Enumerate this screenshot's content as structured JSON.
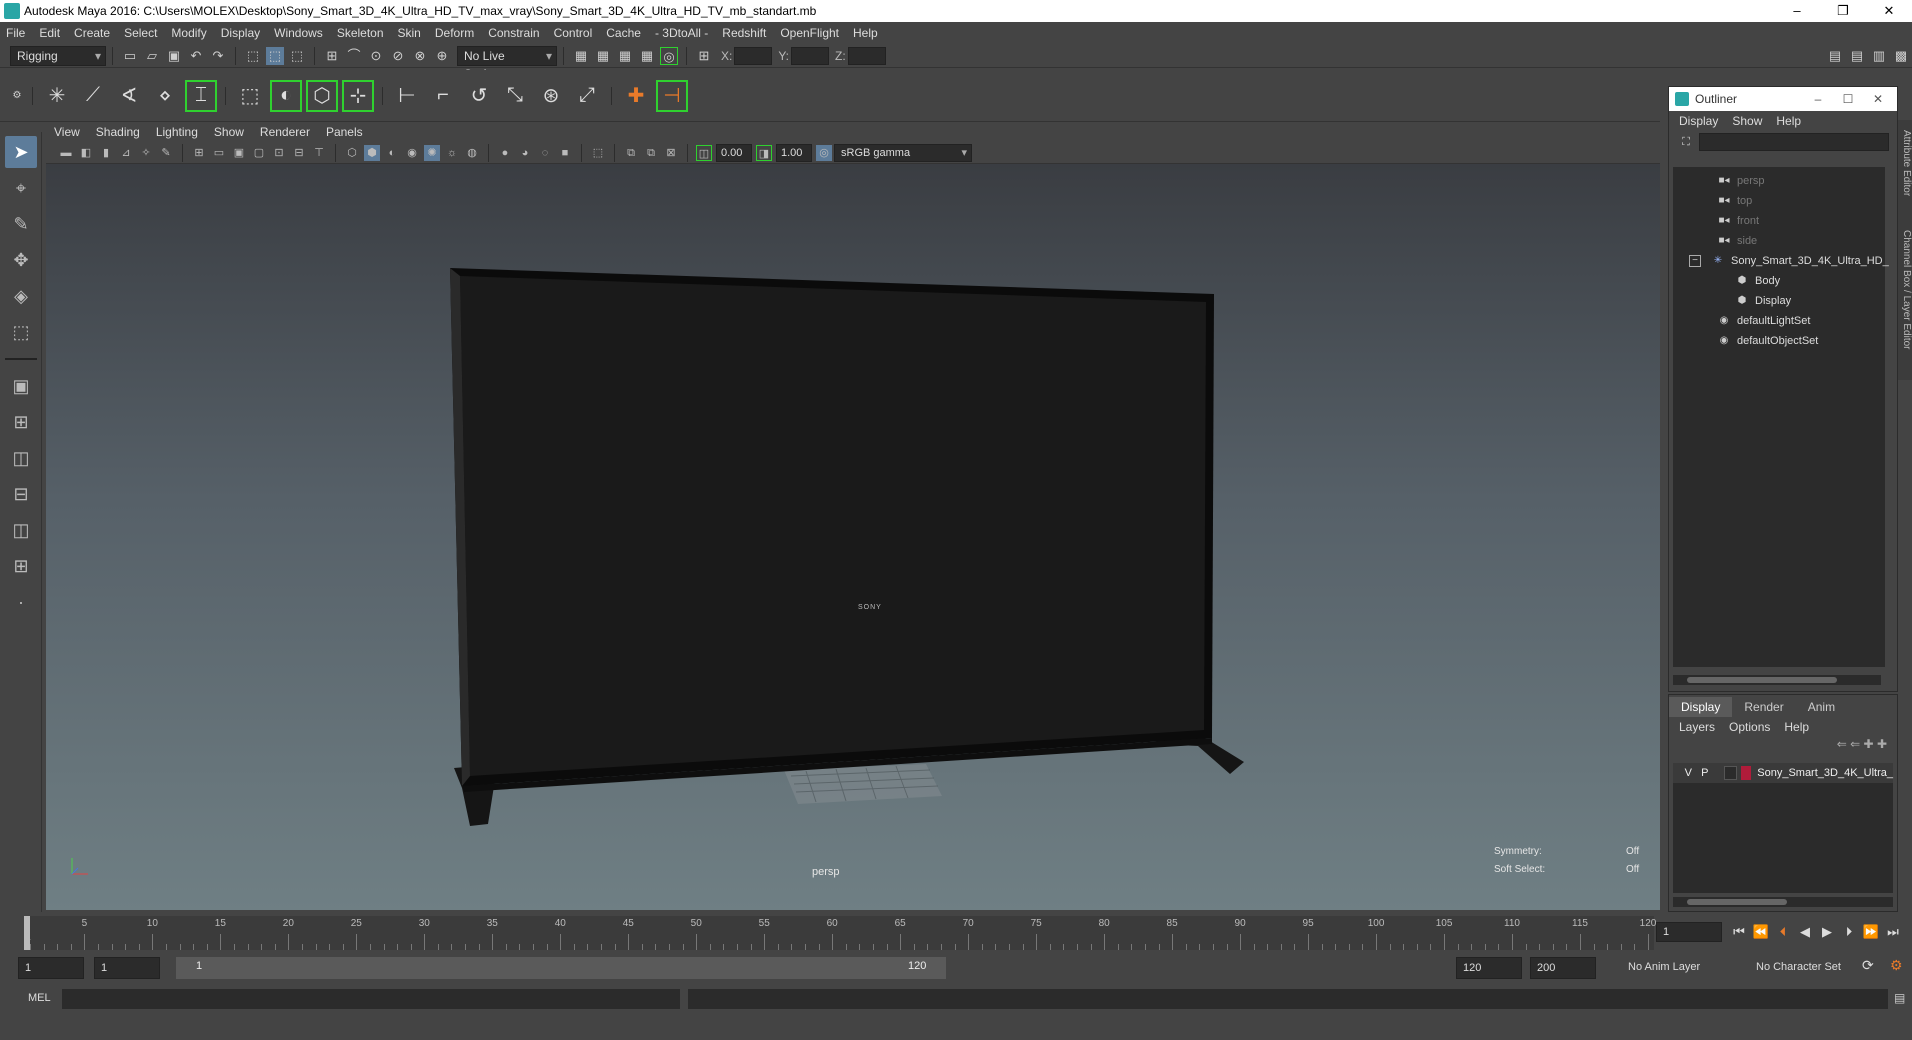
{
  "window": {
    "title": "Autodesk Maya 2016: C:\\Users\\MOLEX\\Desktop\\Sony_Smart_3D_4K_Ultra_HD_TV_max_vray\\Sony_Smart_3D_4K_Ultra_HD_TV_mb_standart.mb",
    "minimize": "–",
    "restore": "❐",
    "close": "✕"
  },
  "menu": [
    "File",
    "Edit",
    "Create",
    "Select",
    "Modify",
    "Display",
    "Windows",
    "Skeleton",
    "Skin",
    "Deform",
    "Constrain",
    "Control",
    "Cache",
    "- 3DtoAll -",
    "Redshift",
    "OpenFlight",
    "Help"
  ],
  "status": {
    "menuset": "Rigging",
    "live_surface": "No Live Surface",
    "x_label": "X:",
    "y_label": "Y:",
    "z_label": "Z:"
  },
  "panel": {
    "menu": [
      "View",
      "Shading",
      "Lighting",
      "Show",
      "Renderer",
      "Panels"
    ],
    "exposure": "0.00",
    "gamma": "1.00",
    "color_space": "sRGB gamma",
    "camera_label": "persp",
    "symmetry_label": "Symmetry:",
    "symmetry_value": "Off",
    "soft_select_label": "Soft Select:",
    "soft_select_value": "Off",
    "tv_brand": "SONY"
  },
  "outliner": {
    "title": "Outliner",
    "menu": [
      "Display",
      "Show",
      "Help"
    ],
    "items": [
      {
        "label": "persp",
        "icon": "camera-icon",
        "dim": true
      },
      {
        "label": "top",
        "icon": "camera-icon",
        "dim": true
      },
      {
        "label": "front",
        "icon": "camera-icon",
        "dim": true
      },
      {
        "label": "side",
        "icon": "camera-icon",
        "dim": true
      },
      {
        "label": "Sony_Smart_3D_4K_Ultra_HD_",
        "icon": "group-icon",
        "dim": false
      },
      {
        "label": "Body",
        "icon": "mesh-icon",
        "dim": false
      },
      {
        "label": "Display",
        "icon": "mesh-icon",
        "dim": false
      },
      {
        "label": "defaultLightSet",
        "icon": "set-icon",
        "dim": false
      },
      {
        "label": "defaultObjectSet",
        "icon": "set-icon",
        "dim": false
      }
    ]
  },
  "side_tabs": [
    "Attribute Editor",
    "Channel Box / Layer Editor"
  ],
  "layers": {
    "tabs": [
      "Display",
      "Render",
      "Anim"
    ],
    "menu": [
      "Layers",
      "Options",
      "Help"
    ],
    "row": {
      "v": "V",
      "p": "P",
      "name": "Sony_Smart_3D_4K_Ultra_",
      "color": "#b01c3a"
    }
  },
  "timeline": {
    "ticks": [
      "5",
      "10",
      "15",
      "20",
      "25",
      "30",
      "35",
      "40",
      "45",
      "50",
      "55",
      "60",
      "65",
      "70",
      "75",
      "80",
      "85",
      "90",
      "95",
      "100",
      "105",
      "110",
      "115",
      "120"
    ],
    "start_label": "1",
    "current_frame": "1"
  },
  "range": {
    "start": "1",
    "playback_start": "1",
    "bar_start": "1",
    "bar_end": "120",
    "playback_end": "120",
    "end": "200",
    "anim_layer": "No Anim Layer",
    "character_set": "No Character Set"
  },
  "cmd": {
    "lang": "MEL"
  }
}
